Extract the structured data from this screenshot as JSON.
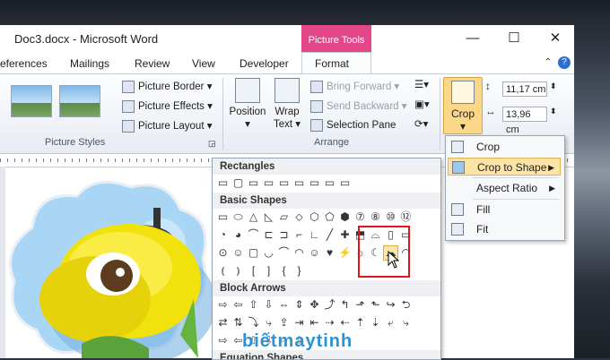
{
  "window": {
    "title": "Doc3.docx - Microsoft Word",
    "context_tab": "Picture Tools",
    "controls": {
      "minimize": "—",
      "maximize": "☐",
      "close": "✕"
    }
  },
  "tabs": [
    "eferences",
    "Mailings",
    "Review",
    "View",
    "Developer",
    "Format"
  ],
  "active_tab": "Format",
  "ribbon": {
    "picture_styles": {
      "label": "Picture Styles",
      "picture_border": "Picture Border",
      "picture_effects": "Picture Effects",
      "picture_layout": "Picture Layout"
    },
    "arrange": {
      "label": "Arrange",
      "position": "Position",
      "wrap_text_line1": "Wrap",
      "wrap_text_line2": "Text",
      "bring_forward": "Bring Forward",
      "send_backward": "Send Backward",
      "selection_pane": "Selection Pane"
    },
    "size": {
      "crop": "Crop",
      "height": "11,17 cm",
      "width": "13,96 cm"
    }
  },
  "crop_menu": {
    "items": [
      {
        "label": "Crop",
        "icon": "crop-icon",
        "submenu": false
      },
      {
        "label": "Crop to Shape",
        "icon": "shape-icon",
        "submenu": true,
        "highlighted": true
      },
      {
        "label": "Aspect Ratio",
        "icon": "",
        "submenu": true
      },
      {
        "label": "Fill",
        "icon": "fill-icon",
        "submenu": false
      },
      {
        "label": "Fit",
        "icon": "fit-icon",
        "submenu": false
      }
    ]
  },
  "shape_gallery": {
    "sections": [
      {
        "title": "Rectangles",
        "rows": [
          [
            "▭",
            "▢",
            "▭",
            "▭",
            "▭",
            "▭",
            "▭",
            "▭",
            "▭"
          ]
        ]
      },
      {
        "title": "Basic Shapes",
        "rows": [
          [
            "▭",
            "⬭",
            "△",
            "◺",
            "▱",
            "⬦",
            "⬡",
            "⬠",
            "⬢",
            "⑦",
            "⑧",
            "⑩",
            "⑫"
          ],
          [
            "◔",
            "◕",
            "⌒",
            "⊏",
            "⊐",
            "⌐",
            "∟",
            "╱",
            "✚",
            "⬒",
            "⌓",
            "▯",
            "▭"
          ],
          [
            "⊙",
            "☺",
            "▢",
            "◡",
            "⌒",
            "◠",
            "☺",
            "♥",
            "⚡",
            "☼",
            "☾",
            "☁",
            "◠"
          ],
          [
            "⦅",
            "⦆",
            "[",
            "]",
            "{",
            "}"
          ]
        ]
      },
      {
        "title": "Block Arrows",
        "rows": [
          [
            "⇨",
            "⇦",
            "⇧",
            "⇩",
            "⇔",
            "⇕",
            "✥",
            "⤴",
            "↰",
            "⬏",
            "⬑",
            "↪",
            "⮌"
          ],
          [
            "⇄",
            "⇅",
            "⤵",
            "⤷",
            "⇪",
            "⇥",
            "⇤",
            "⇢",
            "⇠",
            "⇡",
            "⇣",
            "⤶",
            "⤷"
          ],
          [
            "⇨",
            "⇦",
            "⇧",
            "⇩",
            "⇔",
            "⇕"
          ]
        ]
      },
      {
        "title": "Equation Shapes",
        "rows": []
      }
    ],
    "selected_shape": "cloud"
  },
  "watermark": "biếtmaytinh"
}
